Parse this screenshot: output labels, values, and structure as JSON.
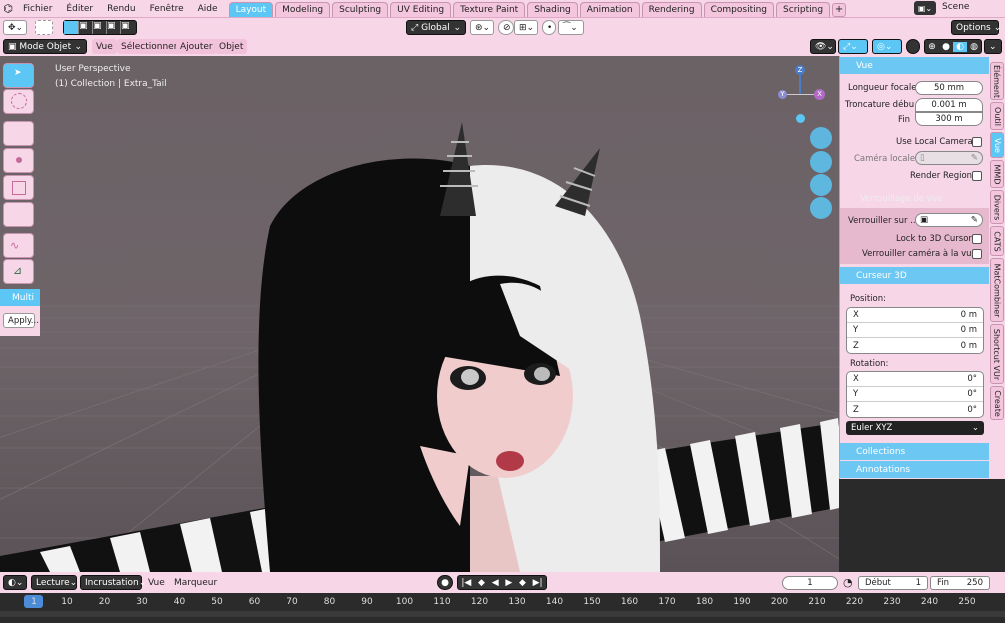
{
  "menu": {
    "items": [
      "Fichier",
      "Éditer",
      "Rendu",
      "Fenêtre",
      "Aide"
    ]
  },
  "workspaces": [
    "Layout",
    "Modeling",
    "Sculpting",
    "UV Editing",
    "Texture Paint",
    "Shading",
    "Animation",
    "Rendering",
    "Compositing",
    "Scripting"
  ],
  "active_workspace": "Layout",
  "scene": {
    "name": "Scene"
  },
  "toolheader": {
    "transform": "Global",
    "options": "Options"
  },
  "viewheader": {
    "mode": "Mode Objet",
    "items": [
      "Vue",
      "Sélectionner",
      "Ajouter",
      "Objet"
    ]
  },
  "viewport": {
    "perspective": "User Perspective",
    "collection": "(1) Collection | Extra_Tail",
    "gizmo": {
      "z": "Z",
      "y": "Y",
      "x": "X"
    }
  },
  "lefttools": {
    "multi": "Multi",
    "apply": "Apply..."
  },
  "npanel": {
    "vue": {
      "title": "Vue",
      "focal_label": "Longueur focale",
      "focal": "50 mm",
      "clip_start_label": "Troncature débu",
      "clip_start": "0.001 m",
      "clip_end_label": "Fin",
      "clip_end": "300 m",
      "local_camera": "Use Local Camera",
      "camera_locale": "Caméra locale",
      "render_region": "Render Region",
      "lock_title": "Verrouillage de vue",
      "lock_to": "Verrouiller sur ...",
      "lock_cursor": "Lock to 3D Cursor",
      "lock_camera": "Verrouiller caméra à la vue"
    },
    "cursor": {
      "title": "Curseur 3D",
      "position": "Position:",
      "x": "0 m",
      "y": "0 m",
      "z": "0 m",
      "rotation": "Rotation:",
      "rx": "0°",
      "ry": "0°",
      "rz": "0°",
      "mode": "Euler XYZ",
      "axis_x": "X",
      "axis_y": "Y",
      "axis_z": "Z"
    },
    "collections": "Collections",
    "annotations": "Annotations"
  },
  "vtabs": [
    "Élément",
    "Outil",
    "Vue",
    "MMD",
    "Divers",
    "CATS",
    "MatCombiner",
    "Shortcut VUr",
    "Create"
  ],
  "active_vtab": "Vue",
  "timeline": {
    "playback": "Lecture",
    "keying": "Incrustation",
    "vue": "Vue",
    "marker": "Marqueur",
    "current_frame": "1",
    "start_label": "Début",
    "start": "1",
    "end_label": "Fin",
    "end": "250",
    "ticks": [
      "1",
      "10",
      "20",
      "30",
      "40",
      "50",
      "60",
      "70",
      "80",
      "90",
      "100",
      "110",
      "120",
      "130",
      "140",
      "150",
      "160",
      "170",
      "180",
      "190",
      "200",
      "210",
      "220",
      "230",
      "240",
      "250"
    ]
  },
  "colors": {
    "accent": "#5cc6f5",
    "panel": "#f7d6e8",
    "viewport": "#6e6469"
  }
}
